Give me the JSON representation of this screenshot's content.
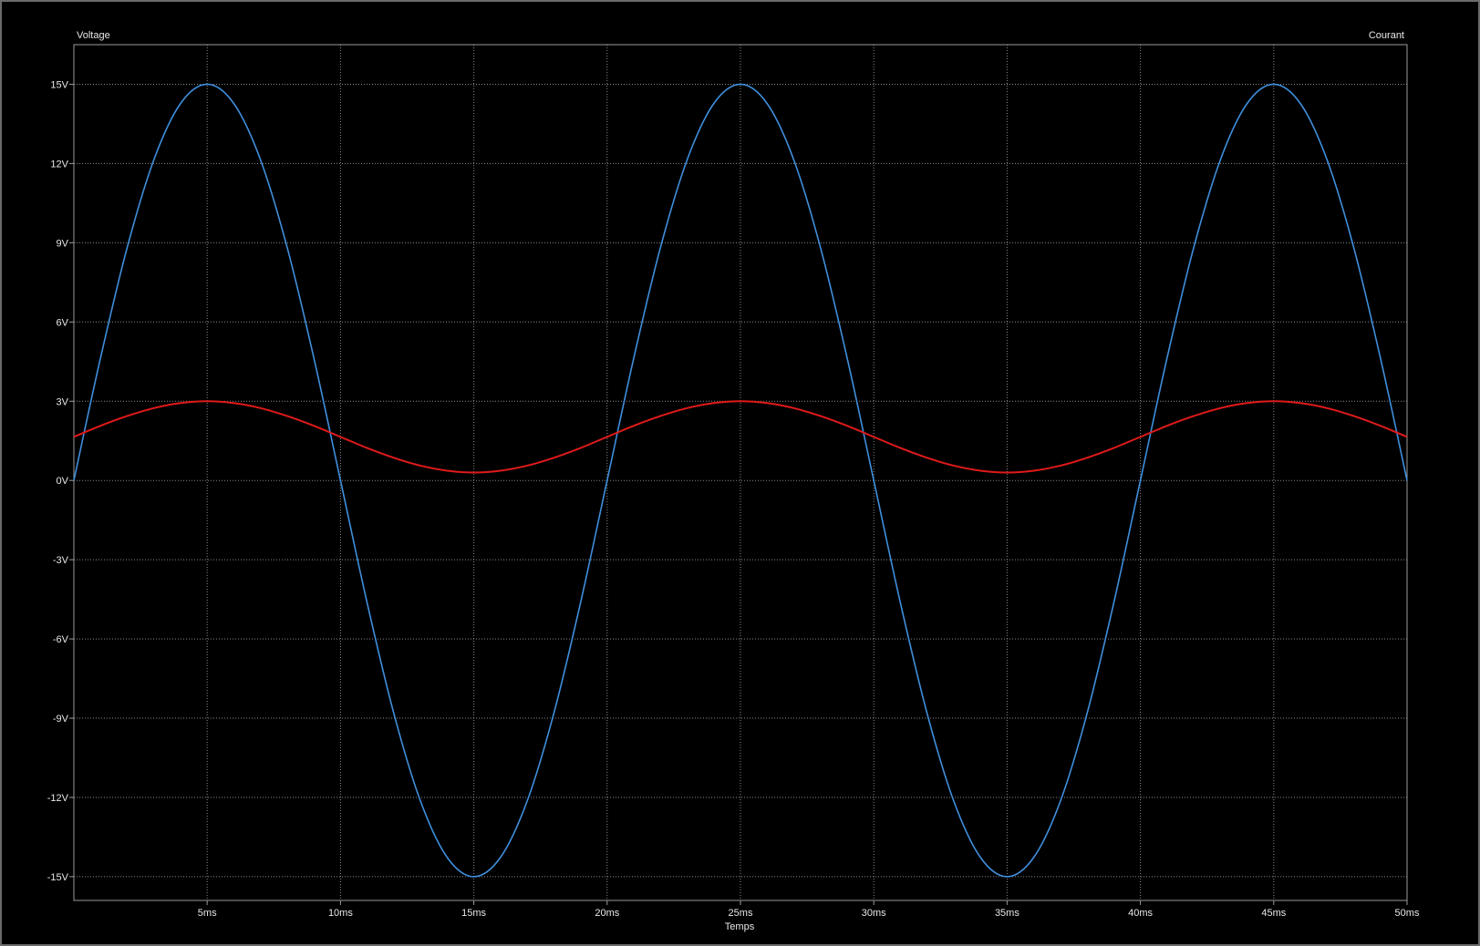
{
  "chart_data": {
    "type": "line",
    "left_axis_title": "Voltage",
    "right_axis_title": "Courant",
    "xlabel": "Temps",
    "xlim": [
      0,
      50
    ],
    "ylim": [
      -15.9,
      16.5
    ],
    "x_ticks": [
      5,
      10,
      15,
      20,
      25,
      30,
      35,
      40,
      45,
      50
    ],
    "x_tick_labels": [
      "5ms",
      "10ms",
      "15ms",
      "20ms",
      "25ms",
      "30ms",
      "35ms",
      "40ms",
      "45ms",
      "50ms"
    ],
    "y_ticks": [
      15,
      12,
      9,
      6,
      3,
      0,
      -3,
      -6,
      -9,
      -12,
      -15
    ],
    "y_tick_labels": [
      "15V",
      "12V",
      "9V",
      "6V",
      "3V",
      "0V",
      "-3V",
      "-6V",
      "-9V",
      "-12V",
      "-15V"
    ],
    "grid": true,
    "colors": {
      "background": "#000000",
      "grid": "#8a8a8a",
      "axis": "#9a9a9a",
      "text": "#e8e8e8"
    },
    "series": [
      {
        "color": "#3f8fdc",
        "x": [
          0,
          1,
          2,
          3,
          4,
          5,
          6,
          7,
          8,
          9,
          10,
          11,
          12,
          13,
          14,
          15,
          16,
          17,
          18,
          19,
          20,
          21,
          22,
          23,
          24,
          25,
          26,
          27,
          28,
          29,
          30,
          31,
          32,
          33,
          34,
          35,
          36,
          37,
          38,
          39,
          40,
          41,
          42,
          43,
          44,
          45,
          46,
          47,
          48,
          49,
          50
        ],
        "values": [
          0,
          4.64,
          8.82,
          12.14,
          14.27,
          15,
          14.27,
          12.14,
          8.82,
          4.64,
          0,
          -4.64,
          -8.82,
          -12.14,
          -14.27,
          -15,
          -14.27,
          -12.14,
          -8.82,
          -4.64,
          0,
          4.64,
          8.82,
          12.14,
          14.27,
          15,
          14.27,
          12.14,
          8.82,
          4.64,
          0,
          -4.64,
          -8.82,
          -12.14,
          -14.27,
          -15,
          -14.27,
          -12.14,
          -8.82,
          -4.64,
          0,
          4.64,
          8.82,
          12.14,
          14.27,
          15,
          14.27,
          12.14,
          8.82,
          4.64,
          0
        ]
      },
      {
        "color": "#e01a1a",
        "x": [
          0,
          1,
          2,
          3,
          4,
          5,
          6,
          7,
          8,
          9,
          10,
          11,
          12,
          13,
          14,
          15,
          16,
          17,
          18,
          19,
          20,
          21,
          22,
          23,
          24,
          25,
          26,
          27,
          28,
          29,
          30,
          31,
          32,
          33,
          34,
          35,
          36,
          37,
          38,
          39,
          40,
          41,
          42,
          43,
          44,
          45,
          46,
          47,
          48,
          49,
          50
        ],
        "values": [
          1.65,
          2.07,
          2.44,
          2.74,
          2.93,
          3.0,
          2.93,
          2.74,
          2.44,
          2.07,
          1.65,
          1.23,
          0.86,
          0.56,
          0.37,
          0.3,
          0.37,
          0.56,
          0.86,
          1.23,
          1.65,
          2.07,
          2.44,
          2.74,
          2.93,
          3.0,
          2.93,
          2.74,
          2.44,
          2.07,
          1.65,
          1.23,
          0.86,
          0.56,
          0.37,
          0.3,
          0.37,
          0.56,
          0.86,
          1.23,
          1.65,
          2.07,
          2.44,
          2.74,
          2.93,
          3.0,
          2.93,
          2.74,
          2.44,
          2.07,
          1.65
        ]
      }
    ]
  }
}
